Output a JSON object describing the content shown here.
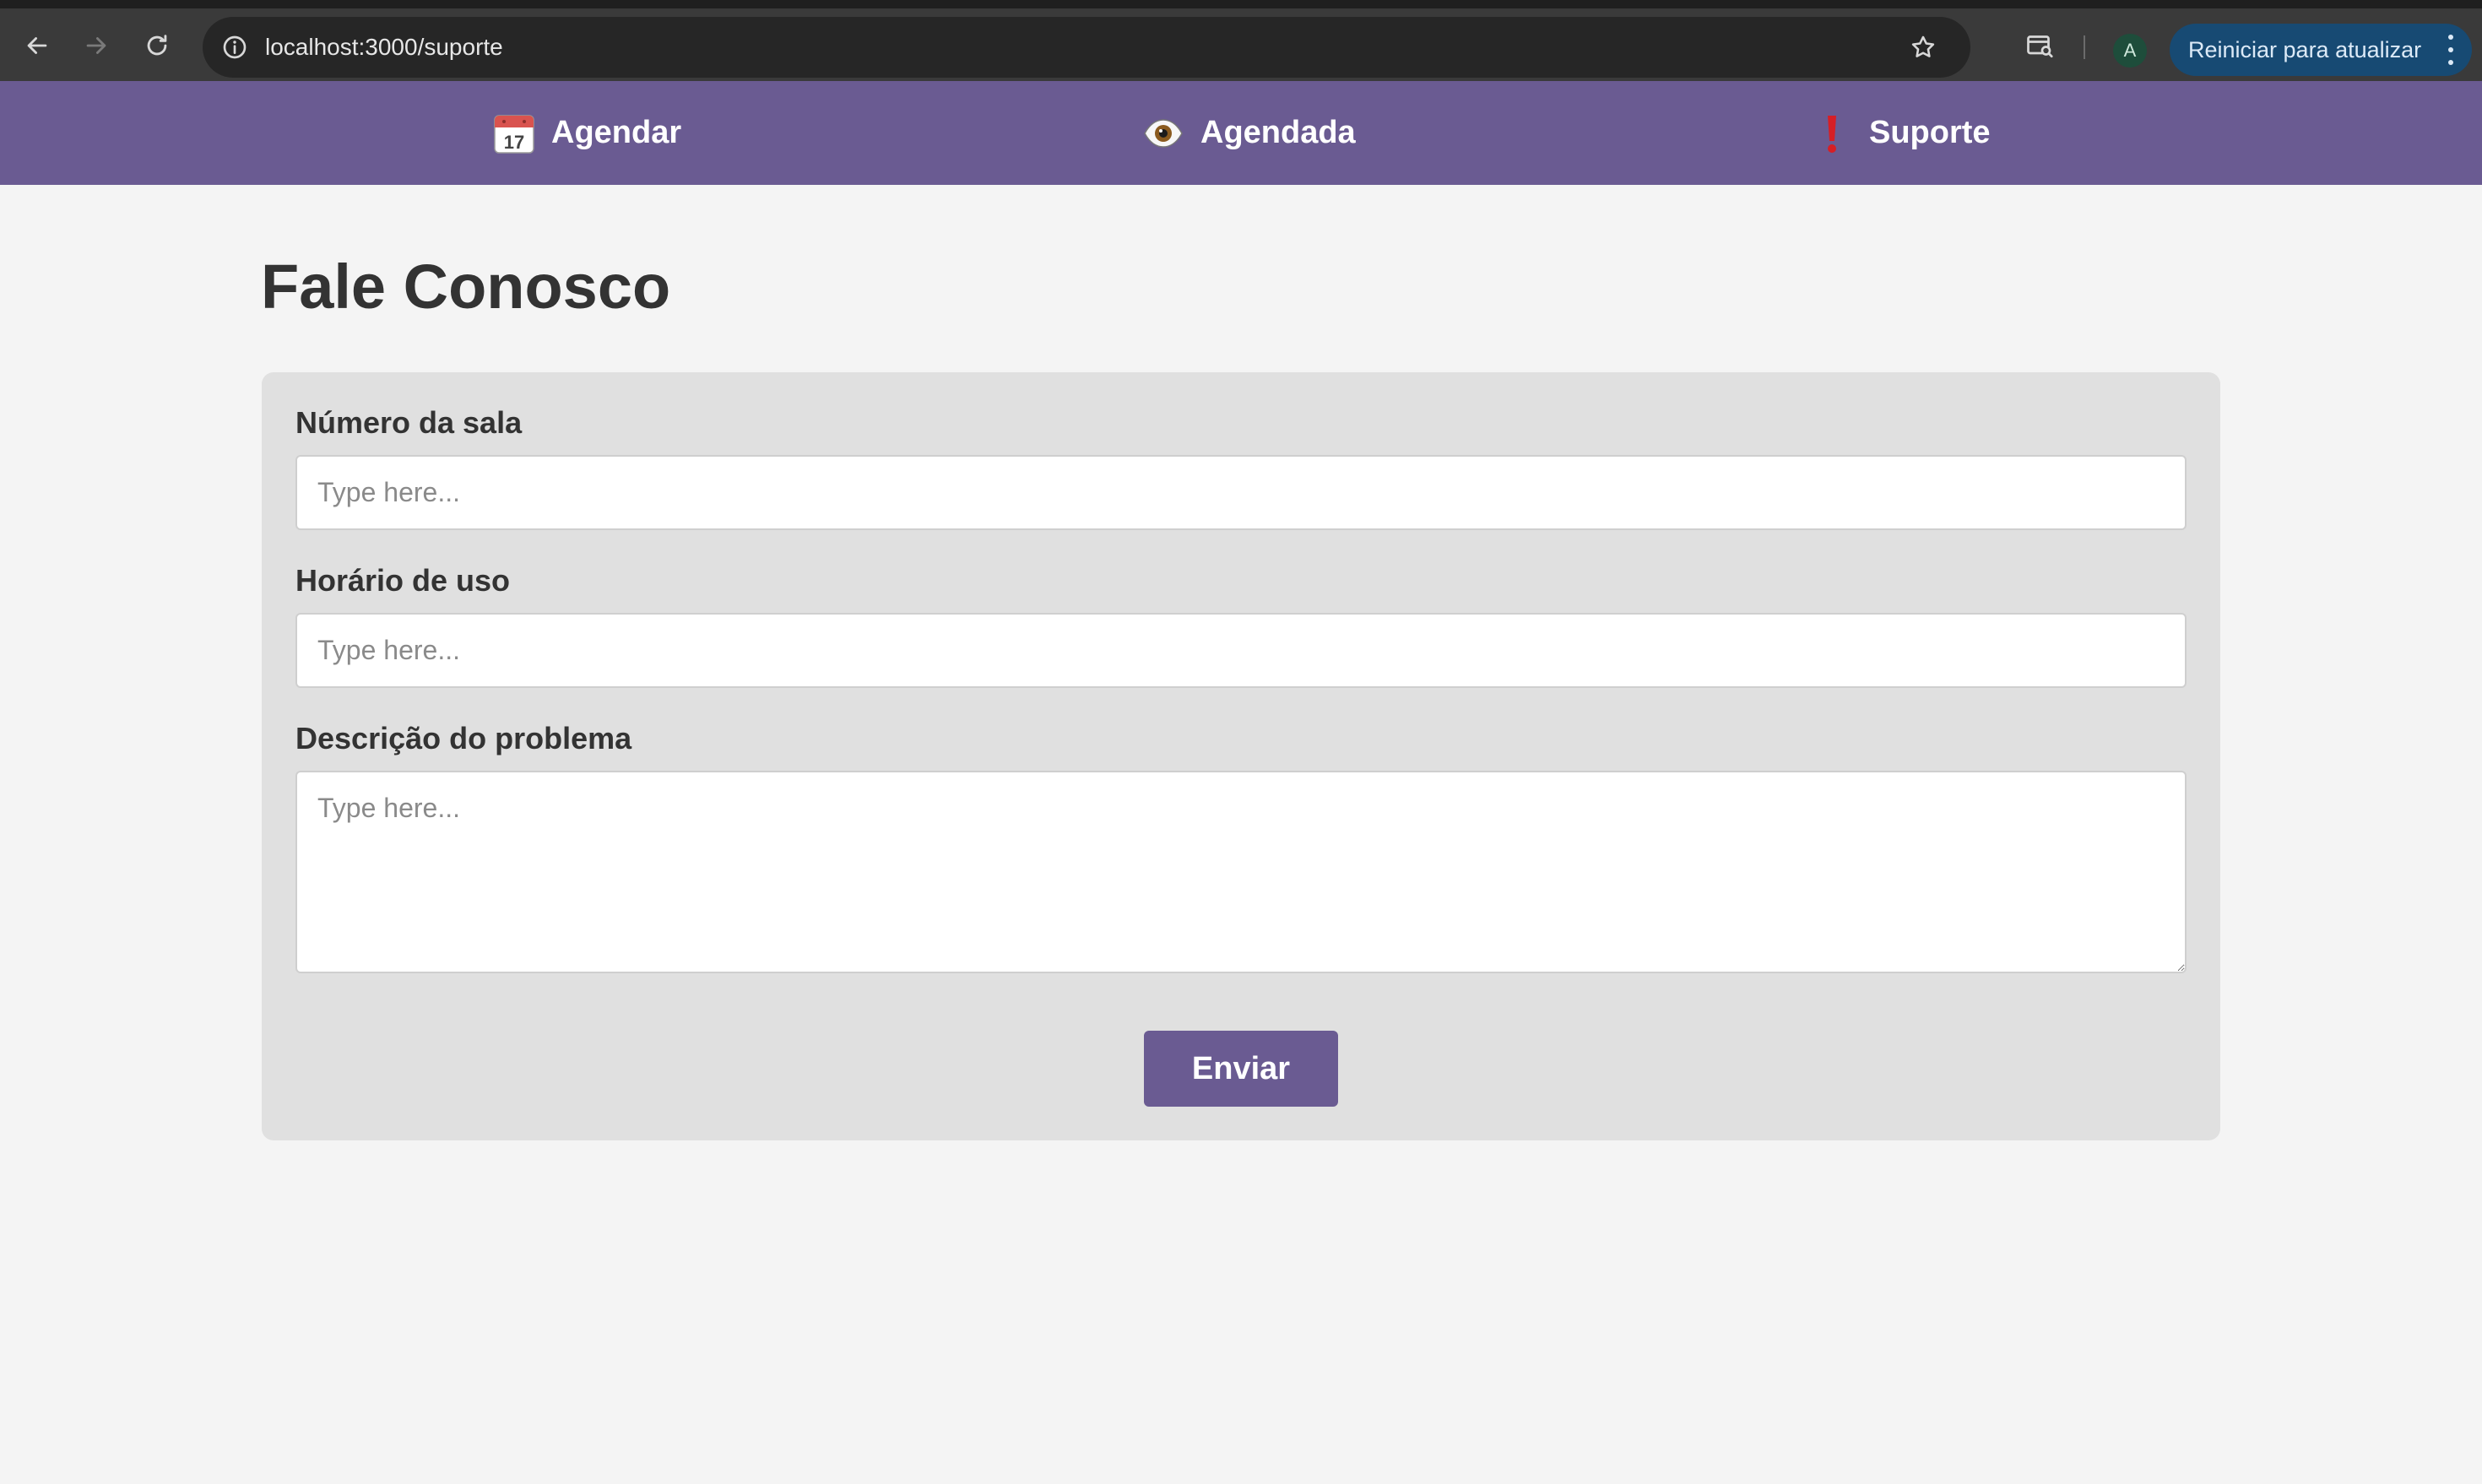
{
  "browser": {
    "url": "localhost:3000/suporte",
    "profile_initial": "A",
    "update_button_label": "Reiniciar para atualizar"
  },
  "nav": {
    "items": [
      {
        "icon": "calendar-icon",
        "label": "Agendar"
      },
      {
        "icon": "eye-icon",
        "label": "Agendada"
      },
      {
        "icon": "exclamation-icon",
        "label": "Suporte"
      }
    ]
  },
  "page": {
    "title": "Fale Conosco"
  },
  "form": {
    "room_number": {
      "label": "Número da sala",
      "placeholder": "Type here...",
      "value": ""
    },
    "usage_time": {
      "label": "Horário de uso",
      "placeholder": "Type here...",
      "value": ""
    },
    "problem_description": {
      "label": "Descrição do problema",
      "placeholder": "Type here...",
      "value": ""
    },
    "submit_label": "Enviar"
  },
  "colors": {
    "accent": "#6a5b92",
    "page_background": "#f4f4f4",
    "card_background": "#e0e0e0",
    "update_button": "#174a73"
  }
}
